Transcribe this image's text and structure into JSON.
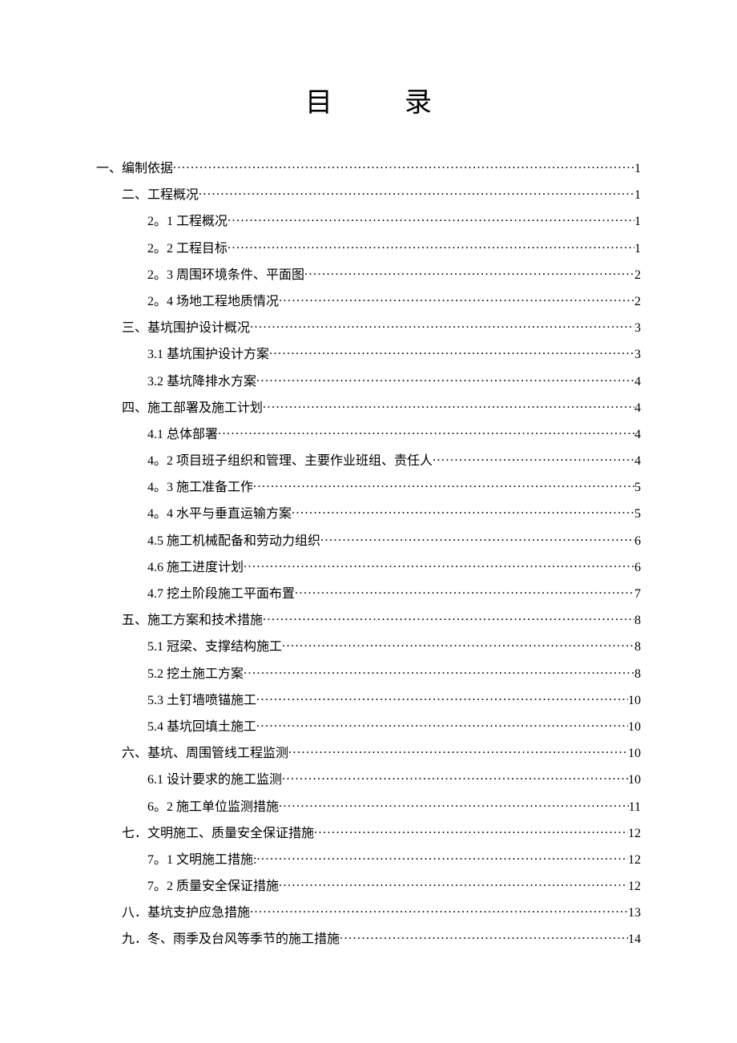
{
  "title_a": "目",
  "title_b": "录",
  "toc": [
    {
      "level": 0,
      "label": "一、编制依据",
      "page": "1"
    },
    {
      "level": 1,
      "label": "二、工程概况",
      "page": "1"
    },
    {
      "level": 2,
      "label": "2。1 工程概况",
      "page": "1"
    },
    {
      "level": 2,
      "label": "2。2 工程目标",
      "page": "1"
    },
    {
      "level": 2,
      "label": "2。3 周围环境条件、平面图",
      "page": "2"
    },
    {
      "level": 2,
      "label": "2。4 场地工程地质情况",
      "page": "2"
    },
    {
      "level": 1,
      "label": "三、基坑围护设计概况",
      "page": "3"
    },
    {
      "level": 2,
      "label": "3.1 基坑围护设计方案",
      "page": "3"
    },
    {
      "level": 2,
      "label": "3.2 基坑降排水方案",
      "page": "4"
    },
    {
      "level": 1,
      "label": "四、施工部署及施工计划",
      "page": "4"
    },
    {
      "level": 2,
      "label": "4.1 总体部署",
      "page": "4"
    },
    {
      "level": 2,
      "label": "4。2 项目班子组织和管理、主要作业班组、责任人",
      "page": "4"
    },
    {
      "level": 2,
      "label": "4。3 施工准备工作",
      "page": "5"
    },
    {
      "level": 2,
      "label": "4。4 水平与垂直运输方案",
      "page": "5"
    },
    {
      "level": 2,
      "label": "4.5 施工机械配备和劳动力组织",
      "page": "6"
    },
    {
      "level": 2,
      "label": "4.6 施工进度计划",
      "page": "6"
    },
    {
      "level": 2,
      "label": "4.7 挖土阶段施工平面布置",
      "page": "7"
    },
    {
      "level": 1,
      "label": "五、施工方案和技术措施",
      "page": "8"
    },
    {
      "level": 2,
      "label": "5.1 冠梁、支撑结构施工",
      "page": "8"
    },
    {
      "level": 2,
      "label": "5.2 挖土施工方案",
      "page": "8"
    },
    {
      "level": 2,
      "label": "5.3 土钉墙喷锚施工",
      "page": "10"
    },
    {
      "level": 2,
      "label": "5.4 基坑回填土施工",
      "page": "10"
    },
    {
      "level": 1,
      "label": "六、基坑、周围管线工程监测",
      "page": "10"
    },
    {
      "level": 2,
      "label": "6.1 设计要求的施工监测",
      "page": "10"
    },
    {
      "level": 2,
      "label": "6。2 施工单位监测措施",
      "page": "11"
    },
    {
      "level": 1,
      "label": "七．文明施工、质量安全保证措施",
      "page": "12"
    },
    {
      "level": 2,
      "label": "7。1 文明施工措施:",
      "page": "12"
    },
    {
      "level": 2,
      "label": "7。2 质量安全保证措施",
      "page": "12"
    },
    {
      "level": 1,
      "label": "八．基坑支护应急措施",
      "page": "13"
    },
    {
      "level": 1,
      "label": "九．冬、雨季及台风等季节的施工措施",
      "page": "14"
    }
  ]
}
